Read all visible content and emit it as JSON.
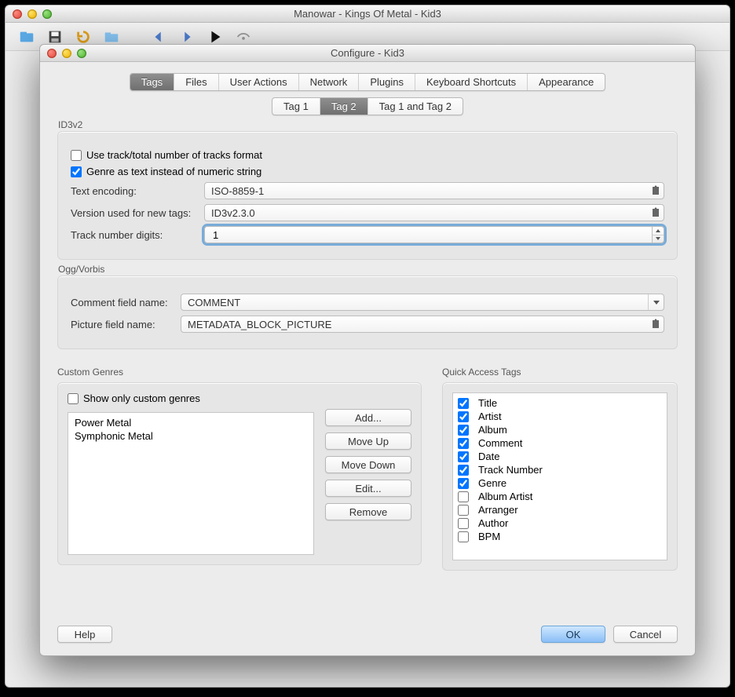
{
  "main_window": {
    "title": "Manowar - Kings Of Metal - Kid3"
  },
  "dialog": {
    "title": "Configure - Kid3",
    "tabs": [
      "Tags",
      "Files",
      "User Actions",
      "Network",
      "Plugins",
      "Keyboard Shortcuts",
      "Appearance"
    ],
    "active_tab": 0,
    "subtabs": [
      "Tag 1",
      "Tag 2",
      "Tag 1 and Tag 2"
    ],
    "active_subtab": 1
  },
  "id3v2": {
    "group_label": "ID3v2",
    "track_total_cb": {
      "checked": false,
      "label": "Use track/total number of tracks format"
    },
    "genre_text_cb": {
      "checked": true,
      "label": "Genre as text instead of numeric string"
    },
    "text_encoding": {
      "label": "Text encoding:",
      "value": "ISO-8859-1"
    },
    "version": {
      "label": "Version used for new tags:",
      "value": "ID3v2.3.0"
    },
    "track_digits": {
      "label": "Track number digits:",
      "value": "1"
    }
  },
  "ogg": {
    "group_label": "Ogg/Vorbis",
    "comment_field": {
      "label": "Comment field name:",
      "value": "COMMENT"
    },
    "picture_field": {
      "label": "Picture field name:",
      "value": "METADATA_BLOCK_PICTURE"
    }
  },
  "custom_genres": {
    "group_label": "Custom Genres",
    "show_only_cb": {
      "checked": false,
      "label": "Show only custom genres"
    },
    "items": [
      "Power Metal",
      "Symphonic Metal"
    ],
    "buttons": {
      "add": "Add...",
      "move_up": "Move Up",
      "move_down": "Move Down",
      "edit": "Edit...",
      "remove": "Remove"
    }
  },
  "quick_access": {
    "group_label": "Quick Access Tags",
    "items": [
      {
        "label": "Title",
        "checked": true
      },
      {
        "label": "Artist",
        "checked": true
      },
      {
        "label": "Album",
        "checked": true
      },
      {
        "label": "Comment",
        "checked": true
      },
      {
        "label": "Date",
        "checked": true
      },
      {
        "label": "Track Number",
        "checked": true
      },
      {
        "label": "Genre",
        "checked": true
      },
      {
        "label": "Album Artist",
        "checked": false
      },
      {
        "label": "Arranger",
        "checked": false
      },
      {
        "label": "Author",
        "checked": false
      },
      {
        "label": "BPM",
        "checked": false
      }
    ]
  },
  "footer": {
    "help": "Help",
    "ok": "OK",
    "cancel": "Cancel"
  }
}
